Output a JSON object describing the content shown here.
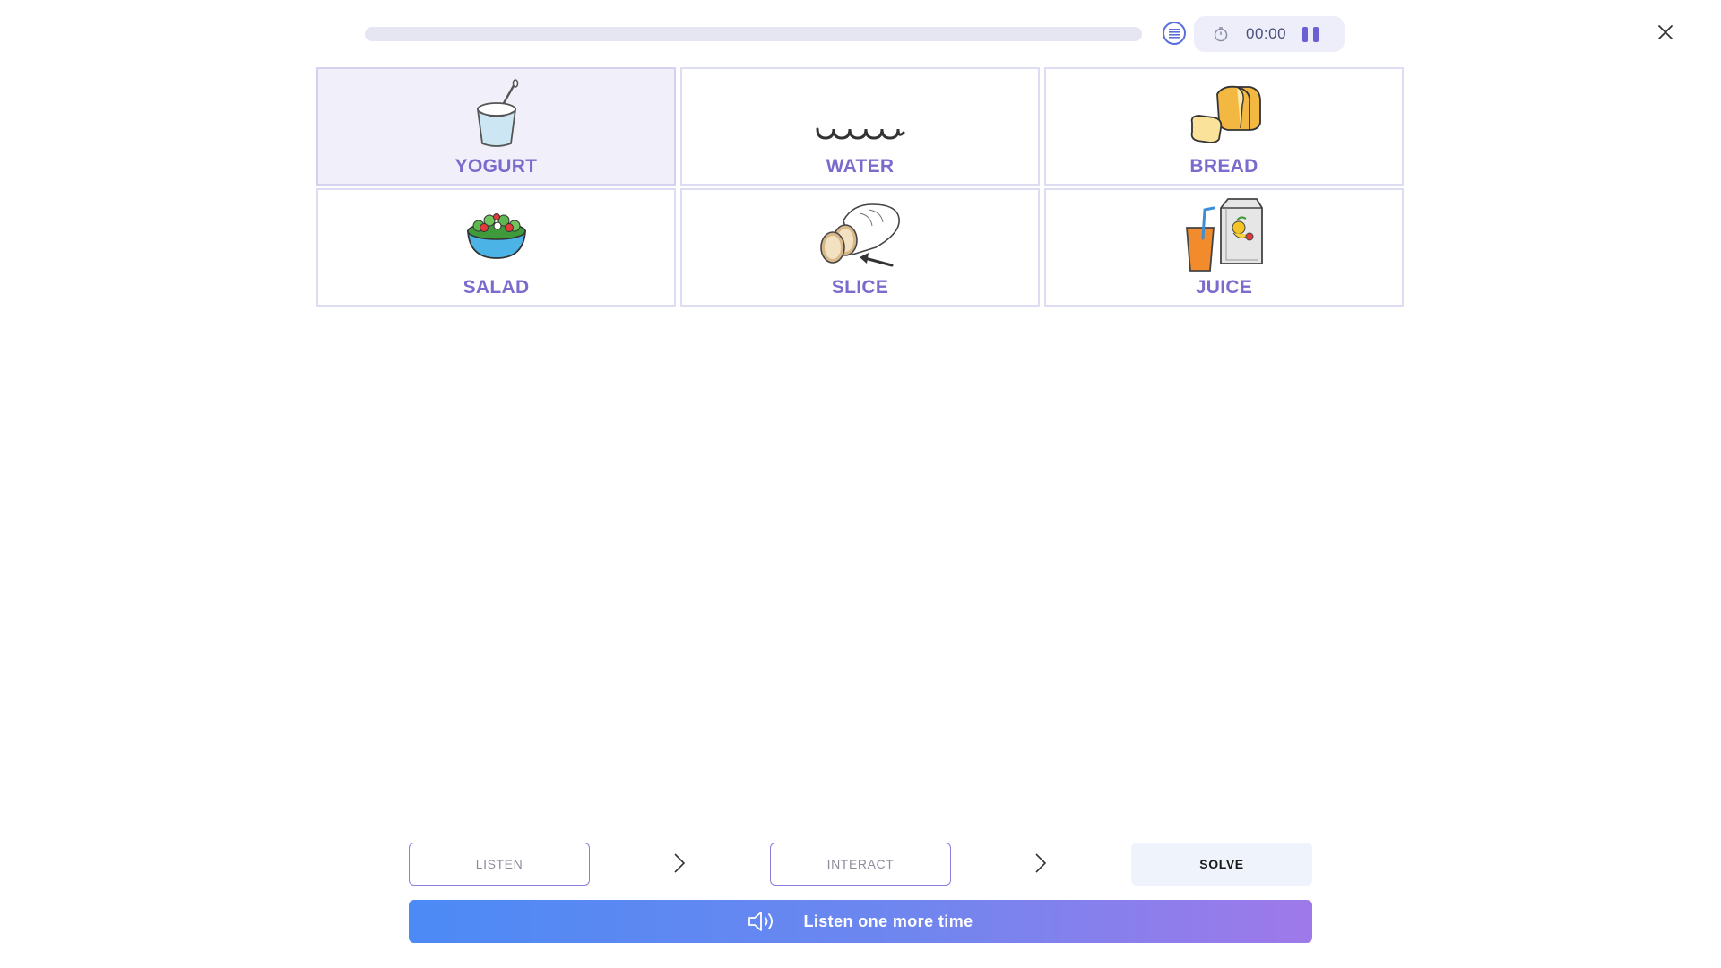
{
  "header": {
    "progress_fraction": 0.0,
    "list_icon": "list-circle-icon",
    "timer_icon": "stopwatch-icon",
    "timer_text": "00:00",
    "pause_icon": "pause-icon",
    "close_icon": "close-icon"
  },
  "cards": [
    {
      "label": "YOGURT",
      "icon": "yogurt-icon",
      "selected": true
    },
    {
      "label": "WATER",
      "icon": "water-icon",
      "selected": false
    },
    {
      "label": "BREAD",
      "icon": "bread-icon",
      "selected": false
    },
    {
      "label": "SALAD",
      "icon": "salad-icon",
      "selected": false
    },
    {
      "label": "SLICE",
      "icon": "slice-icon",
      "selected": false
    },
    {
      "label": "JUICE",
      "icon": "juice-icon",
      "selected": false
    }
  ],
  "steps": {
    "listen": "LISTEN",
    "interact": "INTERACT",
    "solve": "SOLVE"
  },
  "listen_again": {
    "label": "Listen one more time",
    "icon": "speaker-icon"
  },
  "colors": {
    "accent": "#7b6bcc",
    "progress_track": "#e6e6f3",
    "card_border": "#dcdcf2",
    "selected_bg": "#f1effa",
    "button_gradient_start": "#4c8af5",
    "button_gradient_end": "#9f79ea"
  }
}
